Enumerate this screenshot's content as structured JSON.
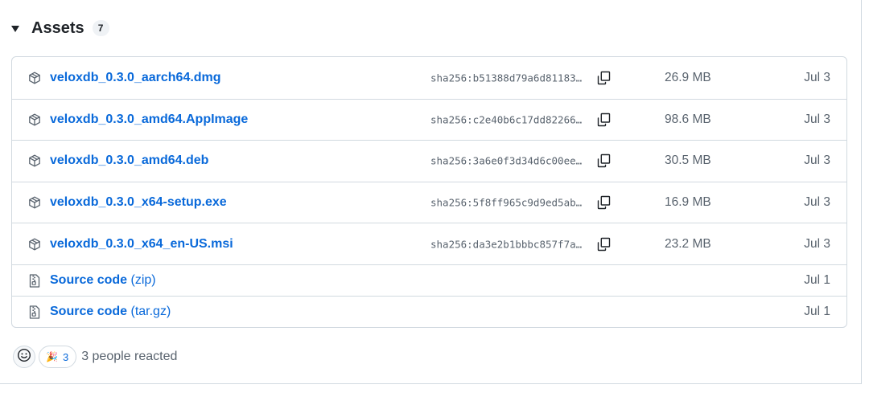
{
  "header": {
    "title": "Assets",
    "count": "7"
  },
  "assets": [
    {
      "name": "veloxdb_0.3.0_aarch64.dmg",
      "sha": "sha256:b51388d79a6d81183…",
      "size": "26.9 MB",
      "date": "Jul 3"
    },
    {
      "name": "veloxdb_0.3.0_amd64.AppImage",
      "sha": "sha256:c2e40b6c17dd82266…",
      "size": "98.6 MB",
      "date": "Jul 3"
    },
    {
      "name": "veloxdb_0.3.0_amd64.deb",
      "sha": "sha256:3a6e0f3d34d6c00ee…",
      "size": "30.5 MB",
      "date": "Jul 3"
    },
    {
      "name": "veloxdb_0.3.0_x64-setup.exe",
      "sha": "sha256:5f8ff965c9d9ed5ab…",
      "size": "16.9 MB",
      "date": "Jul 3"
    },
    {
      "name": "veloxdb_0.3.0_x64_en-US.msi",
      "sha": "sha256:da3e2b1bbbc857f7a…",
      "size": "23.2 MB",
      "date": "Jul 3"
    }
  ],
  "source": [
    {
      "name": "Source code",
      "suffix": "(zip)",
      "date": "Jul 1"
    },
    {
      "name": "Source code",
      "suffix": "(tar.gz)",
      "date": "Jul 1"
    }
  ],
  "reactions": {
    "emoji": "🎉",
    "count": "3",
    "summary": "3 people reacted"
  },
  "icons": {
    "package": "package-icon",
    "file_zip": "file-zip-icon",
    "copy": "copy-icon",
    "smiley": "smiley-icon",
    "caret": "triangle-down-icon"
  },
  "colors": {
    "link": "#0969da",
    "muted": "#59636e",
    "border": "#d1d9e0"
  }
}
